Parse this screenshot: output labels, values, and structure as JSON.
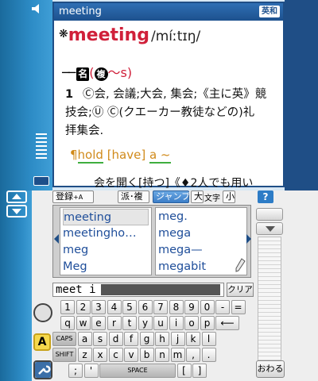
{
  "dictionary": {
    "title": "meeting",
    "badge": "英和",
    "headword_marker": "❋",
    "headword": "meeting",
    "pronunciation": "/míːtɪŋ/",
    "pos_dash": "──",
    "pos": "名",
    "plural_marker": "複",
    "plural_suffix": "〜s",
    "plural_open": "(",
    "plural_close": ")",
    "sense_number": "1",
    "definition_lines": [
      "Ⓒ会, 会議;大会, 集会;《主に英》競",
      "技会;Ⓤ Ⓒ(クエーカー教徒などの)礼",
      "拝集会."
    ],
    "phrase_prefix": "¶",
    "phrase_parts": [
      "hold",
      " [have] ",
      "a ~"
    ],
    "example_line": "会を開く[持つ]《♦2人でも用い"
  },
  "toolbar": {
    "register": "登録",
    "register_sub": "+A",
    "derived": "派･複",
    "jump": "ジャンプ",
    "large": "大",
    "moji": "文字",
    "small": "小",
    "help": "?"
  },
  "word_list": {
    "left": [
      "meeting",
      "meetingho…",
      "meg",
      "Meg"
    ],
    "right": [
      "meg.",
      "mega",
      "mega—",
      "megabit"
    ],
    "selected_index": 0
  },
  "search": {
    "typed": "meet i",
    "clear_label": "クリア"
  },
  "keyboard": {
    "rows": [
      [
        "1",
        "2",
        "3",
        "4",
        "5",
        "6",
        "7",
        "8",
        "9",
        "0",
        "-",
        "="
      ],
      [
        "q",
        "w",
        "e",
        "r",
        "t",
        "y",
        "u",
        "i",
        "o",
        "p",
        "⟵"
      ],
      [
        "CAPS",
        "a",
        "s",
        "d",
        "f",
        "g",
        "h",
        "j",
        "k",
        "l"
      ],
      [
        "SHIFT",
        "z",
        "x",
        "c",
        "v",
        "b",
        "n",
        "m",
        ",",
        "."
      ],
      [
        ";",
        "'",
        "SPACE",
        "[",
        "]"
      ]
    ]
  },
  "side": {
    "a_label": "A"
  },
  "quit_label": "おわる"
}
